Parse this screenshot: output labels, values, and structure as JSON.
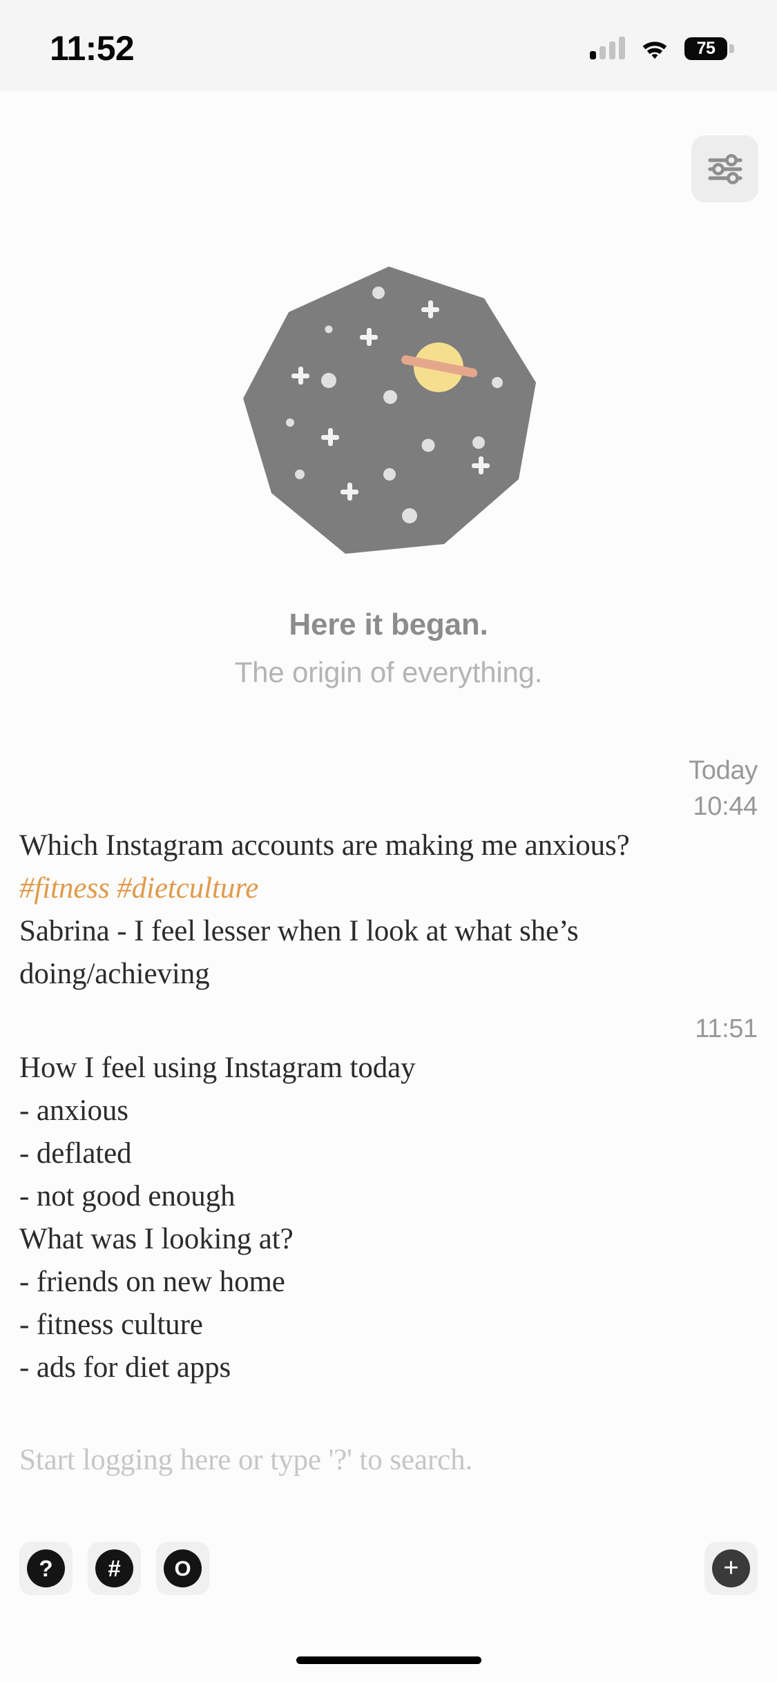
{
  "status_bar": {
    "time": "11:52",
    "battery_level": "75",
    "signal_icon": "cellular-signal-icon",
    "wifi_icon": "wifi-icon",
    "battery_icon": "battery-icon"
  },
  "header": {
    "settings_icon": "sliders-settings-icon"
  },
  "hero": {
    "illustration_icon": "space-nonagon-planet-illustration",
    "title": "Here it began.",
    "subtitle": "The origin of everything.",
    "colors": {
      "nonagon": "#7D7D7D",
      "planet": "#F5DE8E",
      "planet_ring": "#E5A78B",
      "star": "#E8E8E8"
    }
  },
  "feed": {
    "entries": [
      {
        "date_label": "Today",
        "time_label": "10:44",
        "lines": [
          {
            "type": "text",
            "text": "Which Instagram accounts are making me anxious?"
          },
          {
            "type": "tags",
            "text": "#fitness #dietculture"
          },
          {
            "type": "text",
            "text": "Sabrina - I feel lesser when I look at what she’s doing/achieving"
          }
        ]
      },
      {
        "date_label": "",
        "time_label": "11:51",
        "lines": [
          {
            "type": "text",
            "text": "How I feel using Instagram today"
          },
          {
            "type": "text",
            "text": "- anxious"
          },
          {
            "type": "text",
            "text": "- deflated"
          },
          {
            "type": "text",
            "text": "- not good enough"
          },
          {
            "type": "text",
            "text": "What was I looking at?"
          },
          {
            "type": "text",
            "text": "- friends on new home"
          },
          {
            "type": "text",
            "text": "- fitness culture"
          },
          {
            "type": "text",
            "text": "- ads for diet apps"
          }
        ]
      }
    ],
    "placeholder": "Start logging here or type '?' to search.",
    "tag_color": "#E09A4A"
  },
  "toolbar": {
    "buttons": [
      {
        "label": "?",
        "name": "help-button",
        "icon": "question-mark-icon"
      },
      {
        "label": "#",
        "name": "tag-button",
        "icon": "hash-icon"
      },
      {
        "label": "O",
        "name": "object-button",
        "icon": "circle-o-icon"
      }
    ],
    "add": {
      "label": "+",
      "name": "add-button",
      "icon": "plus-icon"
    }
  }
}
